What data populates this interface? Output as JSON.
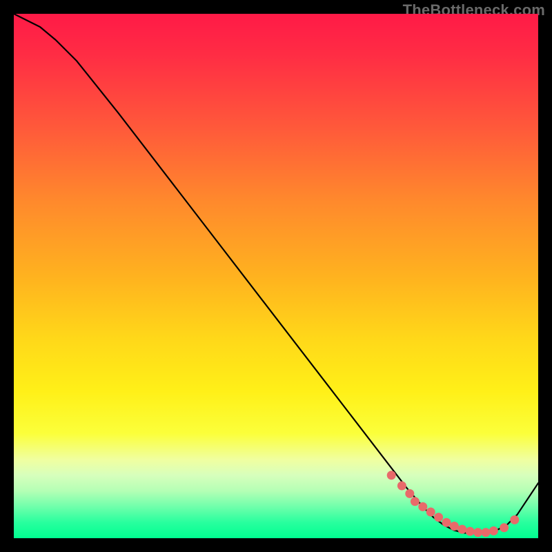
{
  "watermark": "TheBottleneck.com",
  "colors": {
    "gradient_top": "#ff1a47",
    "gradient_bottom": "#00ff91",
    "curve": "#000000",
    "dots": "#e86a6a",
    "frame": "#000000"
  },
  "chart_data": {
    "type": "line",
    "title": "",
    "xlabel": "",
    "ylabel": "",
    "xlim": [
      0,
      100
    ],
    "ylim": [
      0,
      100
    ],
    "x": [
      0,
      2,
      5,
      8,
      12,
      20,
      30,
      40,
      50,
      60,
      70,
      75,
      78,
      80,
      82,
      84,
      86,
      88,
      90,
      92,
      94,
      96,
      98,
      100
    ],
    "y": [
      100,
      99,
      97.5,
      95,
      91,
      81,
      68,
      55,
      42,
      29,
      16,
      9.5,
      6,
      4,
      2.5,
      1.5,
      1,
      1,
      1,
      1.5,
      2.5,
      4.5,
      7.5,
      10.5
    ],
    "marker_series": {
      "name": "highlighted-points",
      "x": [
        72,
        74,
        75.5,
        76.5,
        78,
        79.5,
        81,
        82.5,
        84,
        85.5,
        87,
        88.5,
        90,
        91.5,
        93.5,
        95.5
      ],
      "y": [
        12,
        10,
        8.5,
        7,
        6,
        5,
        4,
        3,
        2.3,
        1.7,
        1.3,
        1.1,
        1.1,
        1.4,
        2,
        3.5
      ]
    }
  }
}
